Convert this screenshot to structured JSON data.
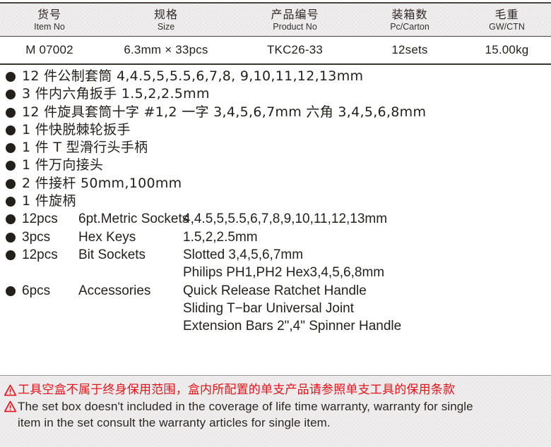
{
  "spec_table": {
    "columns": [
      {
        "cn": "货号",
        "en": "Item No",
        "value": "M 07002"
      },
      {
        "cn": "规格",
        "en": "Size",
        "value": "6.3mm × 33pcs"
      },
      {
        "cn": "产品编号",
        "en": "Product No",
        "value": "TKC26-33"
      },
      {
        "cn": "装箱数",
        "en": "Pc/Carton",
        "value": "12sets"
      },
      {
        "cn": "毛重",
        "en": "GW/CTN",
        "value": "15.00kg"
      }
    ]
  },
  "contents_cn": [
    "12 件公制套筒 4,4.5,5,5.5,6,7,8, 9,10,11,12,13mm",
    "3 件内六角扳手 1.5,2,2.5mm",
    "12 件旋具套筒十字 #1,2   一字 3,4,5,6,7mm  六角 3,4,5,6,8mm",
    "1 件快脱棘轮扳手",
    "1 件 T 型滑行头手柄",
    "1 件万向接头",
    "2 件接杆 50mm,100mm",
    "1 件旋柄"
  ],
  "contents_en": [
    {
      "qty": "12pcs",
      "name": "6pt.Metric Sockets",
      "desc": [
        "4,4.5,5,5.5,6,7,8,9,10,11,12,13mm"
      ]
    },
    {
      "qty": "3pcs",
      "name": "Hex Keys",
      "desc": [
        "1.5,2,2.5mm"
      ]
    },
    {
      "qty": "12pcs",
      "name": "Bit Sockets",
      "desc": [
        "Slotted 3,4,5,6,7mm",
        "Philips PH1,PH2 Hex3,4,5,6,8mm"
      ]
    },
    {
      "qty": "6pcs",
      "name": "Accessories",
      "desc": [
        "Quick Release Ratchet Handle",
        "Sliding T−bar   Universal Joint",
        "Extension Bars 2\",4\"   Spinner Handle"
      ]
    }
  ],
  "warning": {
    "cn": "工具空盒不属于终身保用范围，盒内所配置的单支产品请参照单支工具的保用条款",
    "en_line1": "The set box doesn't included in the coverage of life time warranty, warranty for single",
    "en_line2": "item in the set consult the warranty articles for single item."
  },
  "colors": {
    "warning_red": "#e8131a",
    "text_dark": "#231f1c",
    "panel_gray": "#eeecec"
  }
}
